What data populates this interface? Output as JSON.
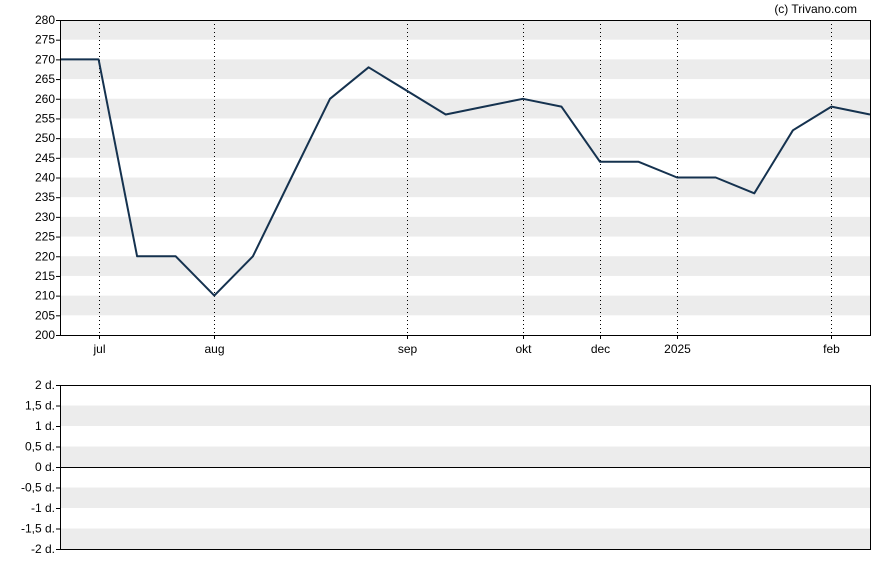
{
  "credit": "(c) Trivano.com",
  "colors": {
    "line": "#15324f",
    "band": "#ececec",
    "background": "#ffffff",
    "axis": "#000000",
    "grid": "#000000"
  },
  "chart_data": [
    {
      "type": "line",
      "ylim": [
        200,
        280
      ],
      "ytick_step": 5,
      "yticks": [
        "200",
        "205",
        "210",
        "215",
        "220",
        "225",
        "230",
        "235",
        "240",
        "245",
        "250",
        "255",
        "260",
        "265",
        "270",
        "275",
        "280"
      ],
      "xticks": [
        {
          "label": "jul",
          "index": 1
        },
        {
          "label": "aug",
          "index": 4
        },
        {
          "label": "sep",
          "index": 9
        },
        {
          "label": "okt",
          "index": 12
        },
        {
          "label": "dec",
          "index": 14
        },
        {
          "label": "2025",
          "index": 16
        },
        {
          "label": "feb",
          "index": 20
        }
      ],
      "vertical_grid": true,
      "series": [
        {
          "values": [
            270,
            270,
            220,
            220,
            210,
            220,
            240,
            260,
            268,
            262,
            256,
            258,
            260,
            258,
            244,
            244,
            240,
            240,
            236,
            252,
            258,
            256
          ]
        }
      ]
    },
    {
      "type": "line",
      "ylim": [
        -2,
        2
      ],
      "yticks": [
        "2 d.",
        "1,5 d.",
        "1 d.",
        "0,5 d.",
        "0 d.",
        "-0,5 d.",
        "-1 d.",
        "-1,5 d.",
        "-2 d."
      ],
      "zero_line": true,
      "series": []
    }
  ]
}
